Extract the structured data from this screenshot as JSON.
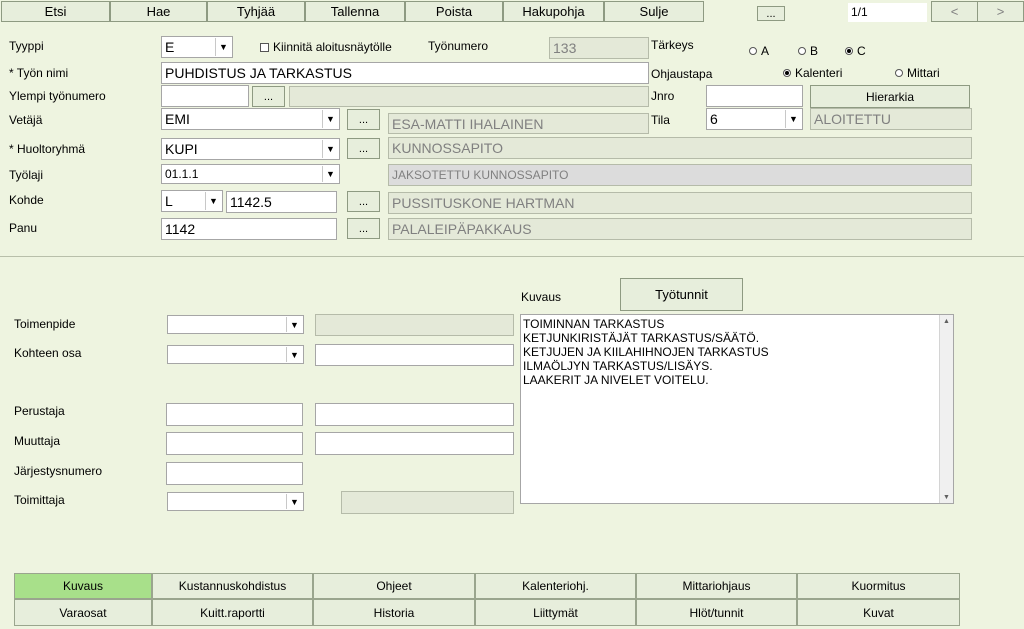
{
  "toolbar": {
    "etsi": "Etsi",
    "hae": "Hae",
    "tyhjaa": "Tyhjää",
    "tallenna": "Tallenna",
    "poista": "Poista",
    "hakupohja": "Hakupohja",
    "sulje": "Sulje",
    "more": "...",
    "record_counter": "1/1",
    "prev": "<",
    "next": ">"
  },
  "header": {
    "tyyppi_label": "Tyyppi",
    "tyyppi_value": "E",
    "kiinnita_label": "Kiinnitä aloitusnäytölle",
    "tyonumero_label": "Työnumero",
    "tyonumero_value": "133",
    "tarkeys_label": "Tärkeys",
    "tarkeys_options": [
      "A",
      "B",
      "C"
    ],
    "tyon_nimi_label": "* Työn nimi",
    "tyon_nimi_value": "PUHDISTUS JA TARKASTUS",
    "ohjaustapa_label": "Ohjaustapa",
    "ohjaustapa_options": [
      "Kalenteri",
      "Mittari"
    ],
    "ylempi_label": "Ylempi työnumero",
    "ylempi_value": "",
    "ylempi_name": "",
    "jnro_label": "Jnro",
    "jnro_value": "",
    "hierarkia_label": "Hierarkia",
    "vetaja_label": "Vetäjä",
    "vetaja_value": "EMI",
    "vetaja_name": "ESA-MATTI IHALAINEN",
    "tila_label": "Tila",
    "tila_value": "6",
    "tila_name": "ALOITETTU",
    "huoltoryhma_label": "* Huoltoryhmä",
    "huoltoryhma_value": "KUPI",
    "huoltoryhma_name": "KUNNOSSAPITO",
    "tyolaji_label": "Työlaji",
    "tyolaji_value": "01.1.1",
    "tyolaji_name": "JAKSOTETTU KUNNOSSAPITO",
    "kohde_label": "Kohde",
    "kohde_type": "L",
    "kohde_value": "1142.5",
    "kohde_name": "PUSSITUSKONE HARTMAN",
    "panu_label": "Panu",
    "panu_value": "1142",
    "panu_name": "PALALEIPÄPAKKAUS",
    "dots": "..."
  },
  "detail": {
    "toimenpide_label": "Toimenpide",
    "toimenpide_value": "",
    "toimenpide_name": "",
    "kohteen_osa_label": "Kohteen osa",
    "kohteen_osa_value": "",
    "kohteen_osa_name": "",
    "perustaja_label": "Perustaja",
    "perustaja_value": "",
    "perustaja_date": "",
    "muuttaja_label": "Muuttaja",
    "muuttaja_value": "",
    "muuttaja_date": "",
    "jarjestys_label": "Järjestysnumero",
    "jarjestys_value": "",
    "toimittaja_label": "Toimittaja",
    "toimittaja_value": "",
    "toimittaja_name": "",
    "kuvaus_label": "Kuvaus",
    "tyotunnit_label": "Työtunnit",
    "kuvaus_lines": [
      "TOIMINNAN TARKASTUS",
      "KETJUNKIRISTÄJÄT TARKASTUS/SÄÄTÖ.",
      "KETJUJEN JA KIILAHIHNOJEN TARKASTUS",
      "ILMAÖLJYN TARKASTUS/LISÄYS.",
      "LAAKERIT JA NIVELET VOITELU."
    ]
  },
  "tabs": {
    "row1": [
      "Kuvaus",
      "Kustannuskohdistus",
      "Ohjeet",
      "Kalenteriohj.",
      "Mittariohjaus",
      "Kuormitus"
    ],
    "row2": [
      "Varaosat",
      "Kuitt.raportti",
      "Historia",
      "Liittymät",
      "Hlöt/tunnit",
      "Kuvat"
    ]
  }
}
